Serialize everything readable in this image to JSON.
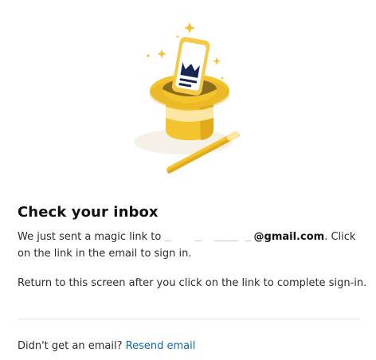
{
  "illustration": {
    "icon": "magic-hat-with-phone-icon",
    "colors": {
      "gold": "#f3c42e",
      "gold_dark": "#e2a91b",
      "cream": "#fbe6a4",
      "navy": "#172554"
    }
  },
  "heading": "Check your inbox",
  "message": {
    "prefix": "We just sent a magic link to",
    "email_domain": "@gmail.com",
    "suffix": ". Click on the link in the email to sign in."
  },
  "instruction": "Return to this screen after you click on the link to complete sign-in.",
  "footer": {
    "prompt": "Didn't get an email?",
    "resend_label": "Resend email"
  },
  "colors": {
    "link": "#0f66b0",
    "divider": "#e3e3e3"
  }
}
